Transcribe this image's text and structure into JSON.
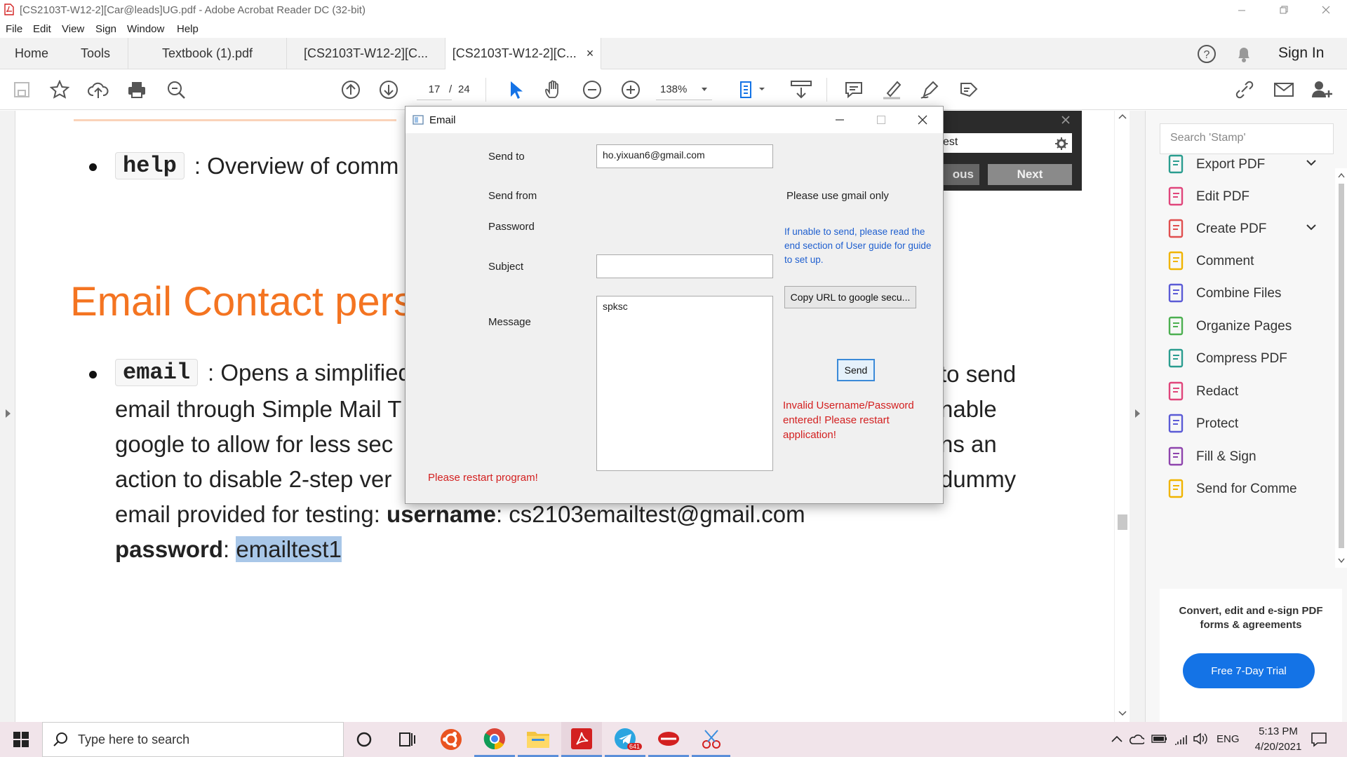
{
  "window": {
    "title": "[CS2103T-W12-2][Car@leads]UG.pdf - Adobe Acrobat Reader DC (32-bit)"
  },
  "menu": [
    "File",
    "Edit",
    "View",
    "Sign",
    "Window",
    "Help"
  ],
  "tabs": {
    "home": "Home",
    "tools": "Tools",
    "docs": [
      "Textbook (1).pdf",
      "[CS2103T-W12-2][C...",
      "[CS2103T-W12-2][C..."
    ],
    "close": "×",
    "sign_in": "Sign In"
  },
  "toolbar": {
    "page_current": "17",
    "page_sep": "/",
    "page_total": "24",
    "zoom": "138%"
  },
  "document": {
    "help_cmd": "help",
    "help_text": ": Overview of comm",
    "heading": "Email Contact perso",
    "email_cmd": "email",
    "line1a": ": Opens a simplified",
    "line1b": "to send",
    "line2a": "email through Simple Mail T",
    "line2b": "nable",
    "line3a": "google to allow for less sec",
    "line3b": "ns an",
    "line4a": "action to disable 2-step ver",
    "line4b": "dummy",
    "line5_pre": "email provided for testing: ",
    "line5_bold": "username",
    "line5_post": ": cs2103emailtest@gmail.com",
    "line6_bold": "password",
    "line6_sep": ": ",
    "line6_sel": "emailtest1"
  },
  "findbar": {
    "text": "est",
    "prev": "ous",
    "next": "Next"
  },
  "dialog": {
    "title": "Email",
    "send_to_label": "Send to",
    "send_to_value": "ho.yixuan6@gmail.com",
    "send_from_label": "Send from",
    "password_label": "Password",
    "subject_label": "Subject",
    "subject_value": "",
    "message_label": "Message",
    "message_value": "spksc",
    "gmail_note": "Please use gmail only",
    "help_note": "If unable to send, please read the end section of User guide for guide to set up.",
    "copy_url_button": "Copy URL to google secu...",
    "send_button": "Send",
    "error_invalid": "Invalid Username/Password entered! Please restart application!",
    "error_restart": "Please restart program!"
  },
  "right_pane": {
    "search_placeholder": "Search 'Stamp'",
    "tools": [
      {
        "label": "Export PDF",
        "color": "#2a9d8f"
      },
      {
        "label": "Edit PDF",
        "color": "#e0457b"
      },
      {
        "label": "Create PDF",
        "color": "#e04f4f"
      },
      {
        "label": "Comment",
        "color": "#f0b400"
      },
      {
        "label": "Combine Files",
        "color": "#5b5bd6"
      },
      {
        "label": "Organize Pages",
        "color": "#4caf50"
      },
      {
        "label": "Compress PDF",
        "color": "#2a9d8f"
      },
      {
        "label": "Redact",
        "color": "#e0457b"
      },
      {
        "label": "Protect",
        "color": "#5b5bd6"
      },
      {
        "label": "Fill & Sign",
        "color": "#8e44ad"
      },
      {
        "label": "Send for Comme",
        "color": "#f0b400"
      }
    ],
    "promo": "Convert, edit and e-sign PDF forms & agreements",
    "trial_button": "Free 7-Day Trial"
  },
  "taskbar": {
    "search_placeholder": "Type here to search",
    "telegram_badge": "641",
    "lang": "ENG",
    "time": "5:13 PM",
    "date": "4/20/2021"
  },
  "colors": {
    "accent": "#1473e6",
    "heading": "#f47421",
    "error": "#d32020",
    "selection": "#a9c7e8"
  }
}
